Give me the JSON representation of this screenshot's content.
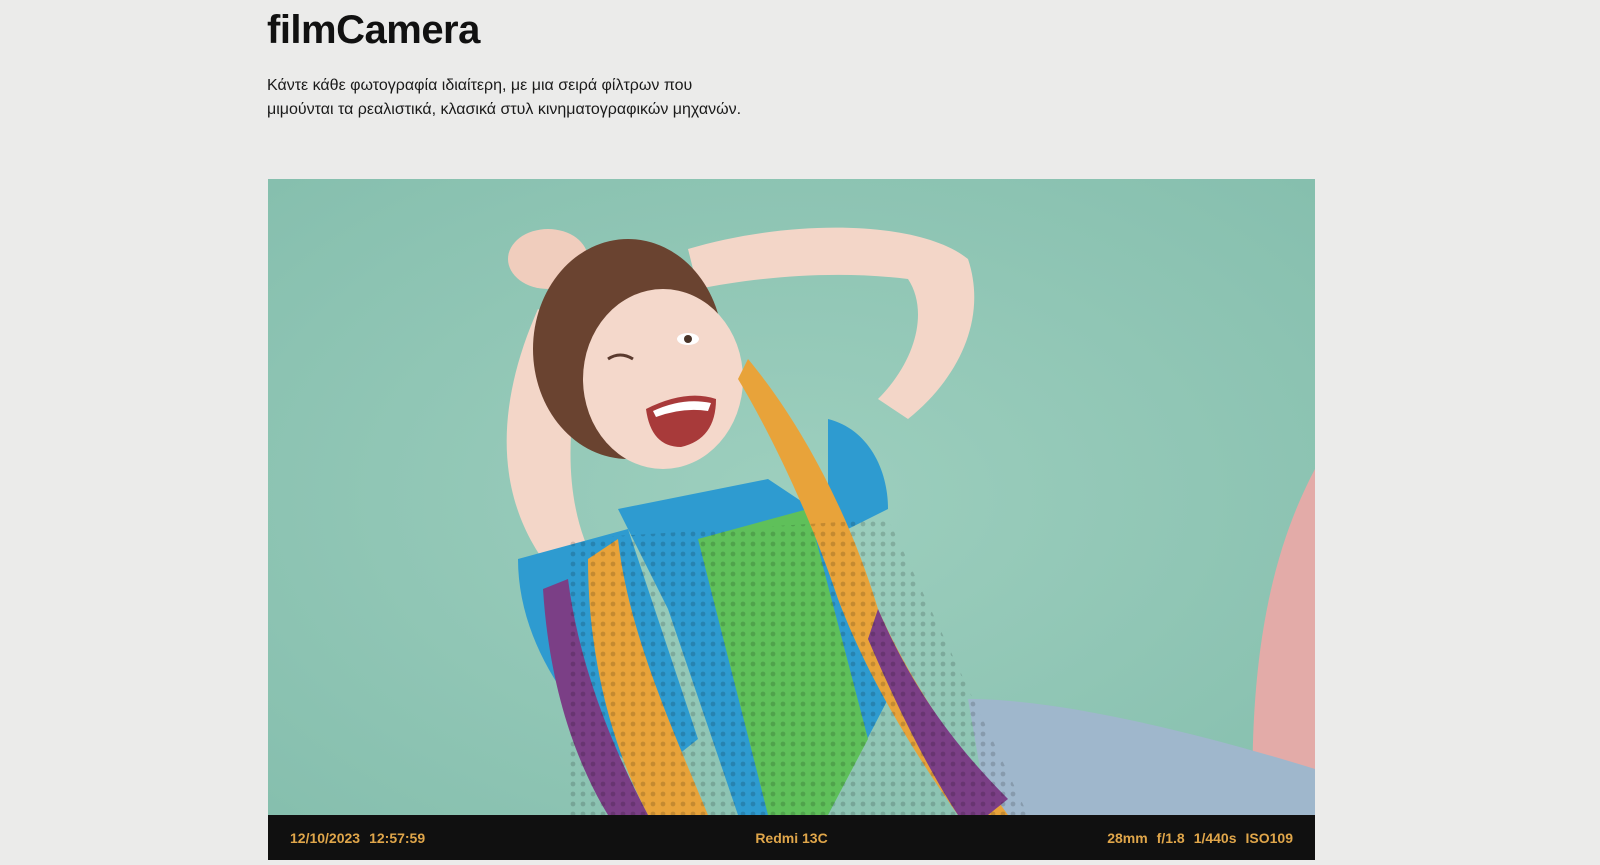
{
  "header": {
    "title": "filmCamera",
    "description_line1": "Κάντε κάθε φωτογραφία ιδιαίτερη, με μια σειρά φίλτρων που",
    "description_line2": "μιμούνται τα ρεαλιστικά, κλασικά στυλ κινηματογραφικών μηχανών."
  },
  "photo": {
    "subject": "laughing-person-in-crochet-vest",
    "colors": {
      "background": "#8fc5b4",
      "vest_orange": "#e8a33a",
      "vest_purple": "#7b3f86",
      "shirt_blue": "#2e9bd0",
      "shirt_green": "#5fc05a",
      "jeans": "#9fb7cc",
      "track_pink": "#e3aba8"
    }
  },
  "exif": {
    "date": "12/10/2023",
    "time": "12:57:59",
    "device": "Redmi 13C",
    "focal": "28mm",
    "aperture": "f/1.8",
    "shutter": "1/440s",
    "iso": "ISO109"
  },
  "theme": {
    "strip_bg": "#101010",
    "strip_text": "#e0a64a",
    "page_bg": "#ebebea"
  }
}
